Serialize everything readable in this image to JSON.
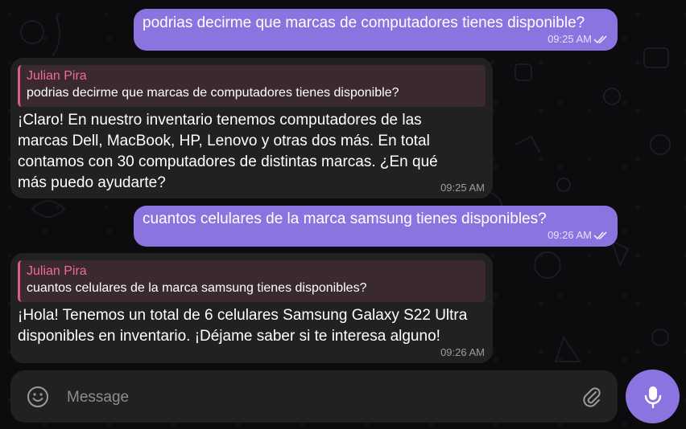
{
  "messages": [
    {
      "direction": "outgoing",
      "text": "podrias decirme que marcas de computadores tienes disponible?",
      "time": "09:25 AM",
      "status_icon": "double-check-icon"
    },
    {
      "direction": "incoming",
      "reply_to": {
        "name": "Julian Pira",
        "text": "podrias decirme que marcas de computadores tienes disponible?"
      },
      "lines": [
        "¡Claro! En nuestro inventario tenemos computadores de las",
        "marcas Dell, MacBook, HP, Lenovo y otras dos más. En total",
        "contamos con 30 computadores de distintas marcas. ¿En qué",
        "más puedo ayudarte?"
      ],
      "time": "09:25 AM"
    },
    {
      "direction": "outgoing",
      "text": "cuantos celulares de la marca samsung tienes disponibles?",
      "time": "09:26 AM",
      "status_icon": "double-check-icon"
    },
    {
      "direction": "incoming",
      "reply_to": {
        "name": "Julian Pira",
        "text": "cuantos celulares de la marca samsung tienes disponibles?"
      },
      "lines": [
        "¡Hola! Tenemos un total de 6 celulares Samsung Galaxy S22 Ultra",
        "disponibles en inventario. ¡Déjame saber si te interesa alguno!"
      ],
      "time": "09:26 AM"
    }
  ],
  "composer": {
    "placeholder": "Message",
    "emoji_icon": "emoji-icon",
    "attach_icon": "paperclip-icon",
    "send_icon": "microphone-icon"
  },
  "colors": {
    "outgoing_bubble": "#8b74e0",
    "incoming_bubble": "#212121",
    "reply_accent": "#e05a86",
    "reply_name": "#ef6a9a",
    "background": "#0c0c0e"
  }
}
